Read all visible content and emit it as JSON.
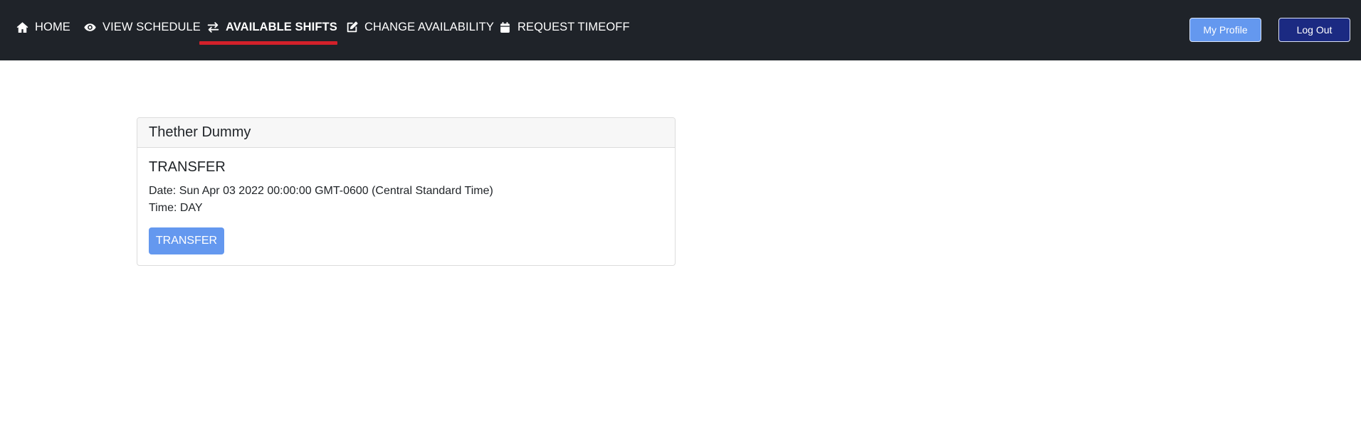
{
  "nav": {
    "items": [
      {
        "label": "HOME",
        "icon": "home-icon"
      },
      {
        "label": "VIEW SCHEDULE",
        "icon": "eye-icon"
      },
      {
        "label": "AVAILABLE SHIFTS",
        "icon": "arrows-exchange-icon",
        "active": true
      },
      {
        "label": "CHANGE AVAILABILITY",
        "icon": "edit-icon"
      },
      {
        "label": "REQUEST TIMEOFF",
        "icon": "calendar-icon"
      }
    ],
    "profile_label": "My Profile",
    "logout_label": "Log Out"
  },
  "shift_card": {
    "employee_name": "Thether Dummy",
    "type": "TRANSFER",
    "date_line": "Date: Sun Apr 03 2022 00:00:00 GMT-0600 (Central Standard Time)",
    "time_line": "Time: DAY",
    "action_label": "TRANSFER"
  },
  "colors": {
    "navbar_bg": "#1f2329",
    "active_underline": "#d3202a",
    "primary_button": "#6498ef",
    "logout_button": "#1b2a82"
  }
}
